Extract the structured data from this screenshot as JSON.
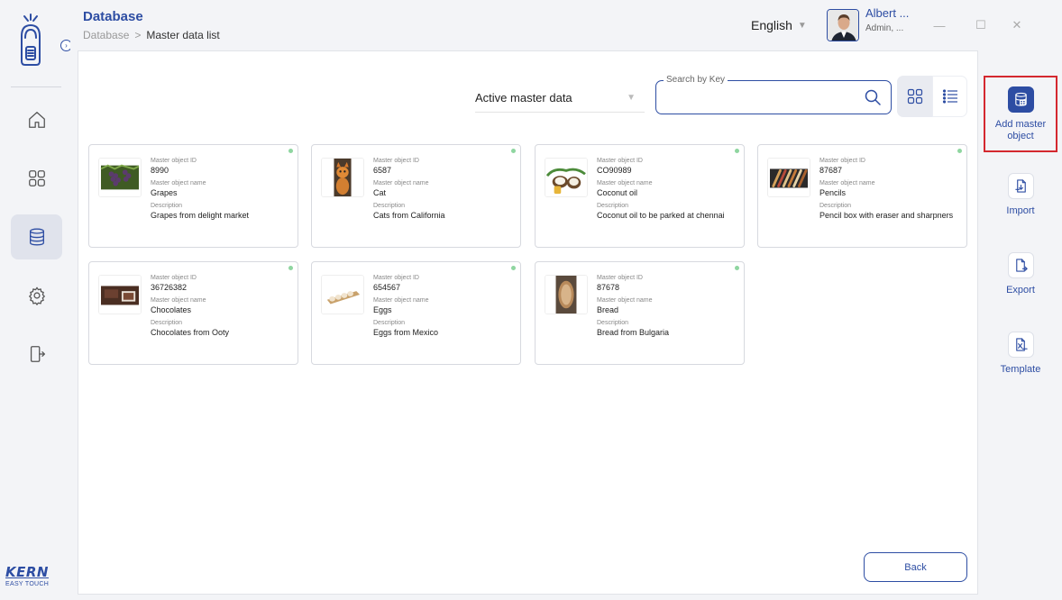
{
  "header": {
    "title": "Database",
    "breadcrumb": [
      "Database",
      "Master data list"
    ],
    "breadcrumb_sep": ">",
    "language": "English",
    "user_name": "Albert ...",
    "user_role": "Admin, ..."
  },
  "window": {
    "minimize": "—",
    "maximize": "☐",
    "close": "✕"
  },
  "brand": {
    "name": "KERN",
    "tagline": "EASY TOUCH",
    "color": "#2d4da3"
  },
  "sidebar": {
    "items": [
      {
        "name": "home",
        "icon": "home-icon"
      },
      {
        "name": "apps",
        "icon": "grid-icon"
      },
      {
        "name": "database",
        "icon": "database-icon",
        "active": true
      },
      {
        "name": "settings",
        "icon": "gear-icon"
      },
      {
        "name": "logout",
        "icon": "logout-icon"
      }
    ]
  },
  "filters": {
    "status_value": "Active master data",
    "search_label": "Search by Key",
    "search_value": ""
  },
  "labels": {
    "id": "Master object ID",
    "name": "Master object name",
    "description": "Description"
  },
  "cards": [
    {
      "id": "8990",
      "name": "Grapes",
      "description": "Grapes from delight market",
      "image": "grapes"
    },
    {
      "id": "6587",
      "name": "Cat",
      "description": "Cats from California",
      "image": "cat"
    },
    {
      "id": "CO90989",
      "name": "Coconut oil",
      "description": "Coconut oil to be parked at chennai",
      "image": "coconut"
    },
    {
      "id": "87687",
      "name": "Pencils",
      "description": "Pencil box with eraser and sharpners",
      "image": "pencils"
    },
    {
      "id": "36726382",
      "name": "Chocolates",
      "description": "Chocolates from Ooty",
      "image": "chocolates"
    },
    {
      "id": "654567",
      "name": "Eggs",
      "description": "Eggs from Mexico",
      "image": "eggs"
    },
    {
      "id": "87678",
      "name": "Bread",
      "description": "Bread from Bulgaria",
      "image": "bread"
    }
  ],
  "actions": {
    "add": "Add master object",
    "import": "Import",
    "export": "Export",
    "template": "Template"
  },
  "footer": {
    "back": "Back"
  },
  "colors": {
    "accent": "#2d4da3",
    "highlight": "#d4282f",
    "status_active": "#8fd6a0"
  }
}
